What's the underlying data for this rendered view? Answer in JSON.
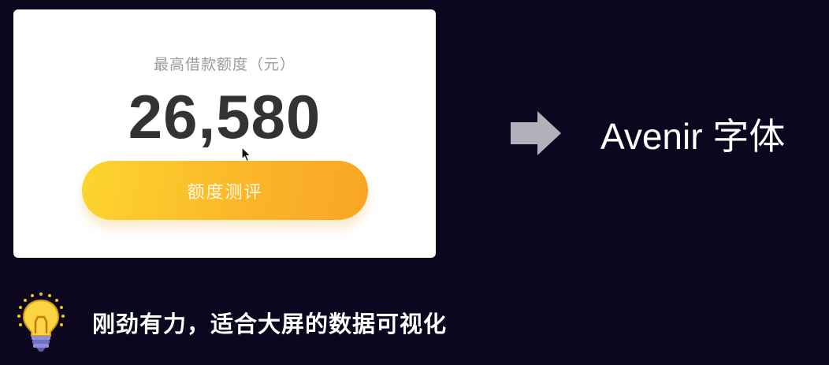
{
  "card": {
    "label": "最高借款额度（元）",
    "amount": "26,580",
    "button_label": "额度测评"
  },
  "arrow_icon": "right-arrow-icon",
  "font_name": "Avenir 字体",
  "tip": {
    "icon": "lightbulb-icon",
    "text": "刚劲有力，适合大屏的数据可视化"
  },
  "colors": {
    "background": "#0c061f",
    "button_start": "#fcd52f",
    "button_end": "#f9a526",
    "amount": "#333333",
    "label": "#9b9b9b"
  }
}
